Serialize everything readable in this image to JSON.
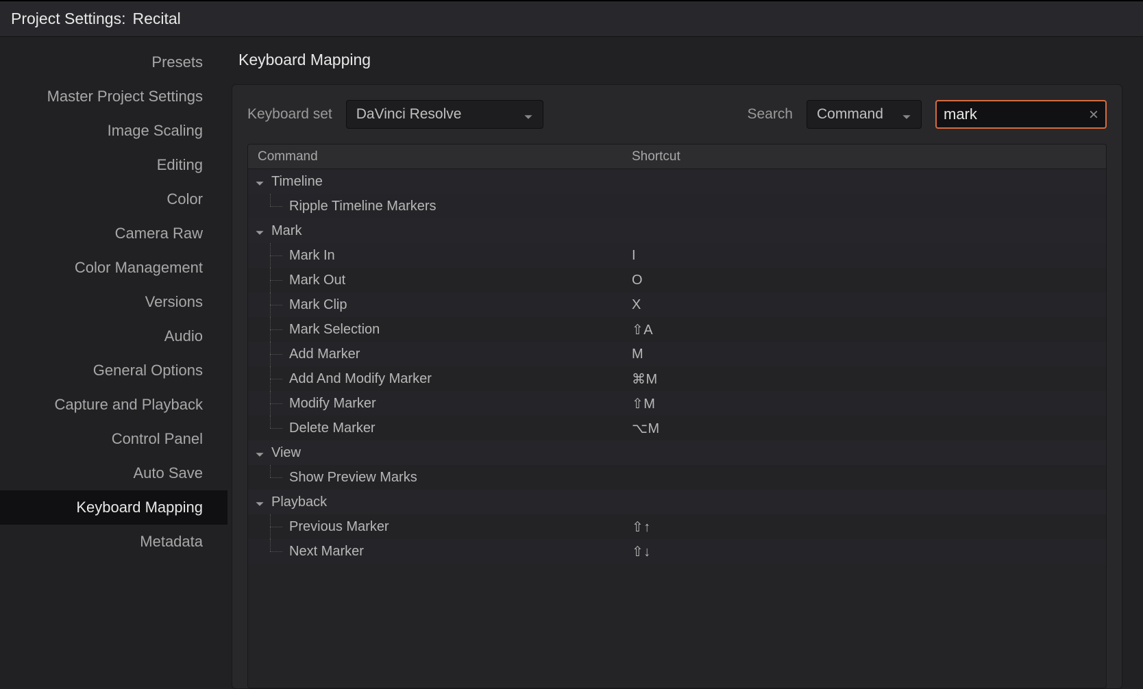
{
  "window": {
    "title_label": "Project Settings:",
    "project_name": "Recital"
  },
  "sidebar": {
    "items": [
      {
        "label": "Presets",
        "active": false
      },
      {
        "label": "Master Project Settings",
        "active": false
      },
      {
        "label": "Image Scaling",
        "active": false
      },
      {
        "label": "Editing",
        "active": false
      },
      {
        "label": "Color",
        "active": false
      },
      {
        "label": "Camera Raw",
        "active": false
      },
      {
        "label": "Color Management",
        "active": false
      },
      {
        "label": "Versions",
        "active": false
      },
      {
        "label": "Audio",
        "active": false
      },
      {
        "label": "General Options",
        "active": false
      },
      {
        "label": "Capture and Playback",
        "active": false
      },
      {
        "label": "Control Panel",
        "active": false
      },
      {
        "label": "Auto Save",
        "active": false
      },
      {
        "label": "Keyboard Mapping",
        "active": true
      },
      {
        "label": "Metadata",
        "active": false
      }
    ]
  },
  "panel": {
    "title": "Keyboard Mapping",
    "keyboard_set_label": "Keyboard set",
    "keyboard_set_value": "DaVinci Resolve",
    "search_label": "Search",
    "search_mode": "Command",
    "search_value": "mark"
  },
  "table": {
    "headers": {
      "command": "Command",
      "shortcut": "Shortcut"
    },
    "groups": [
      {
        "name": "Timeline",
        "expanded": true,
        "items": [
          {
            "command": "Ripple Timeline Markers",
            "shortcut": ""
          }
        ]
      },
      {
        "name": "Mark",
        "expanded": true,
        "items": [
          {
            "command": "Mark In",
            "shortcut": "I"
          },
          {
            "command": "Mark Out",
            "shortcut": "O"
          },
          {
            "command": "Mark Clip",
            "shortcut": "X"
          },
          {
            "command": "Mark Selection",
            "shortcut": "⇧A"
          },
          {
            "command": "Add Marker",
            "shortcut": "M"
          },
          {
            "command": "Add And Modify Marker",
            "shortcut": "⌘M"
          },
          {
            "command": "Modify Marker",
            "shortcut": "⇧M"
          },
          {
            "command": "Delete Marker",
            "shortcut": "⌥M"
          }
        ]
      },
      {
        "name": "View",
        "expanded": true,
        "items": [
          {
            "command": "Show Preview Marks",
            "shortcut": ""
          }
        ]
      },
      {
        "name": "Playback",
        "expanded": true,
        "items": [
          {
            "command": "Previous Marker",
            "shortcut": "⇧↑"
          },
          {
            "command": "Next Marker",
            "shortcut": "⇧↓"
          }
        ]
      }
    ]
  }
}
